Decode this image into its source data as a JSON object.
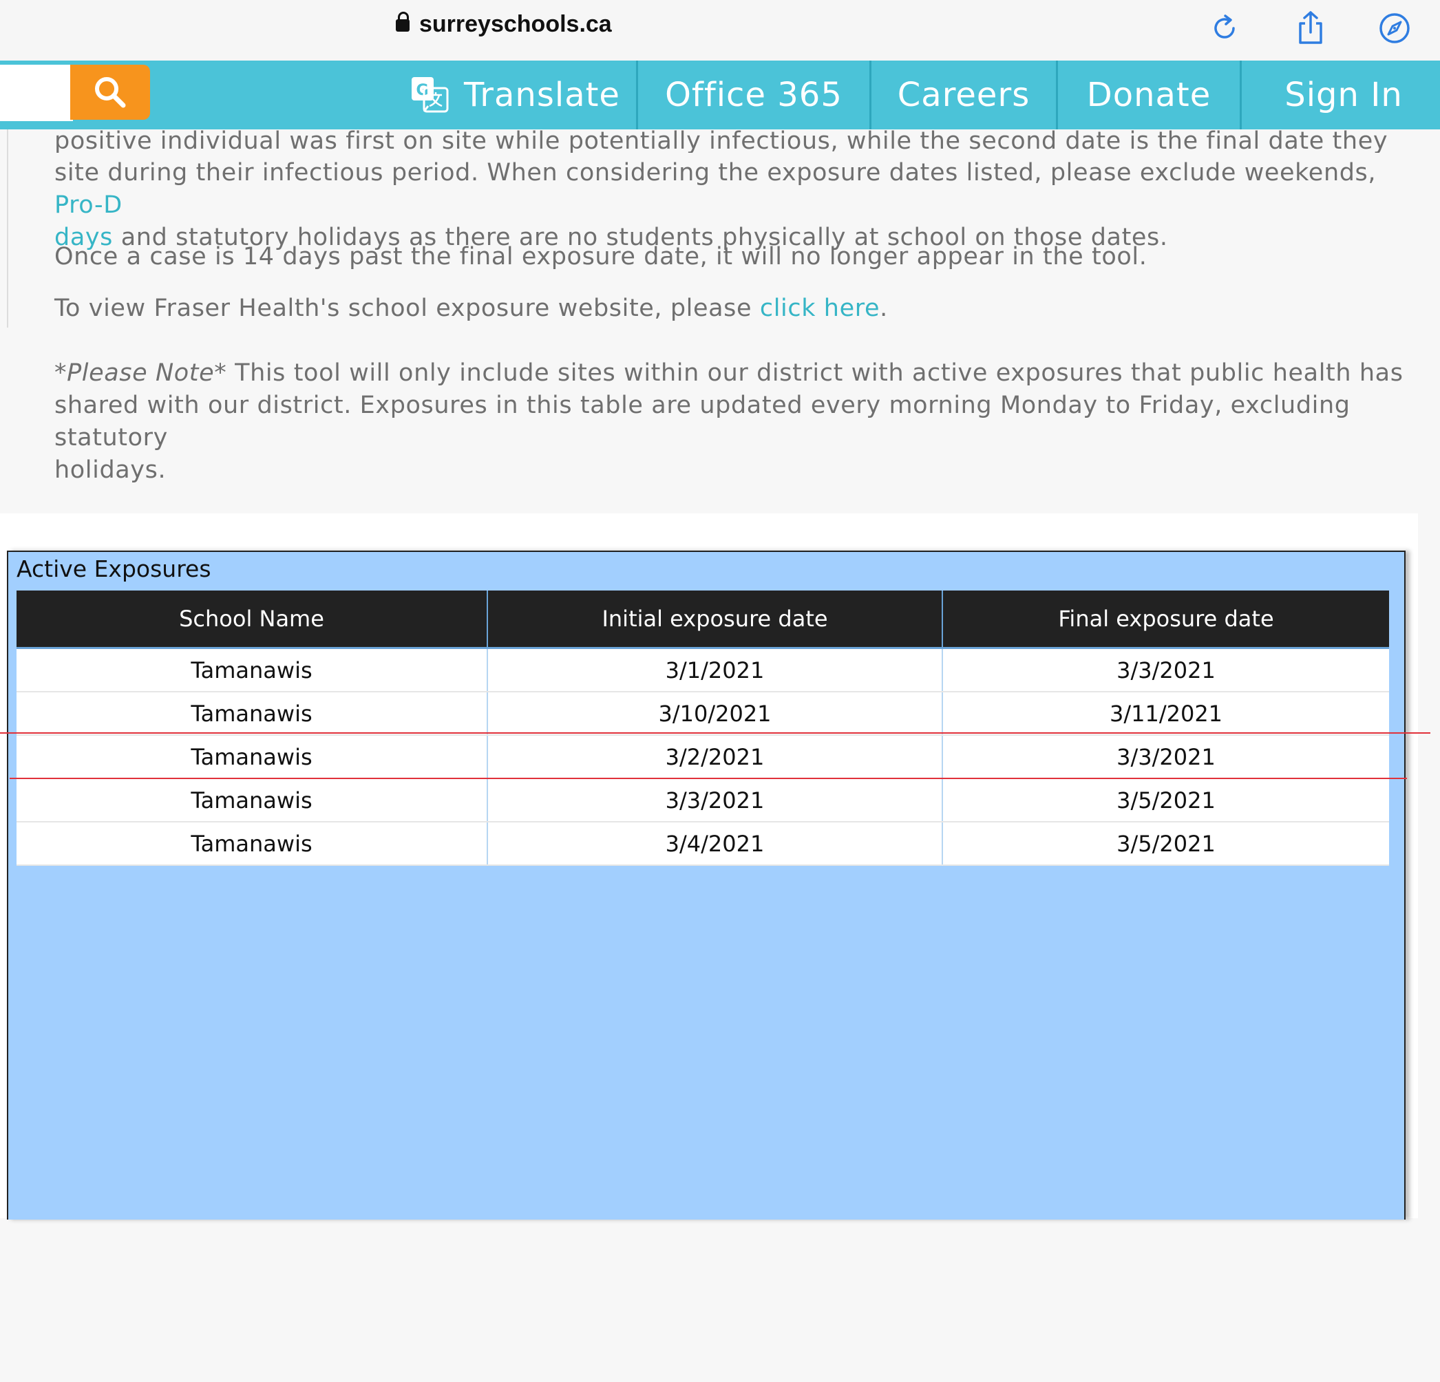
{
  "browser": {
    "url": "surreyschools.ca",
    "icons": [
      "lock-icon",
      "reload-icon",
      "share-icon",
      "compass-icon"
    ]
  },
  "nav": {
    "search_placeholder": "",
    "items": [
      {
        "label": "Translate",
        "icon": "translate-icon"
      },
      {
        "label": "Office 365"
      },
      {
        "label": "Careers"
      },
      {
        "label": "Donate"
      },
      {
        "label": "Sign In"
      }
    ]
  },
  "article": {
    "p1_line1": "positive individual was first on site while potentially infectious, while the second date is the final date they were on",
    "p1_line2_text": "site during their infectious period. When considering the exposure dates listed, please exclude weekends, ",
    "p1_link_part1": "Pro-D",
    "p1_link_part2": "days",
    "p1_line3_text": " and statutory holidays as there are no students physically at school on those dates.",
    "p2": "Once a case is 14 days past the final exposure date, it will no longer appear in the tool.",
    "p3_text": "To view Fraser Health's school exposure website, please ",
    "p3_link": "click here",
    "p3_end": ".",
    "note_label": "*Please Note*",
    "note_line1": "  This tool will only include sites within our district with active exposures that public health has",
    "note_line2": "shared with our district. Exposures in this table are updated every morning Monday to Friday, excluding statutory",
    "note_line3": "holidays."
  },
  "table": {
    "title": "Active Exposures",
    "columns": [
      "School Name",
      "Initial exposure date",
      "Final exposure date"
    ],
    "rows": [
      [
        "Tamanawis",
        "3/1/2021",
        "3/3/2021"
      ],
      [
        "Tamanawis",
        "3/10/2021",
        "3/11/2021"
      ],
      [
        "Tamanawis",
        "3/2/2021",
        "3/3/2021"
      ],
      [
        "Tamanawis",
        "3/3/2021",
        "3/5/2021"
      ],
      [
        "Tamanawis",
        "3/4/2021",
        "3/5/2021"
      ]
    ]
  },
  "colors": {
    "nav_bg": "#4bc3d8",
    "search_button": "#f7941d",
    "link": "#36b5c6",
    "card_bg": "#a2cffe",
    "header_bg": "#222222",
    "markup_line": "#e0313a"
  }
}
